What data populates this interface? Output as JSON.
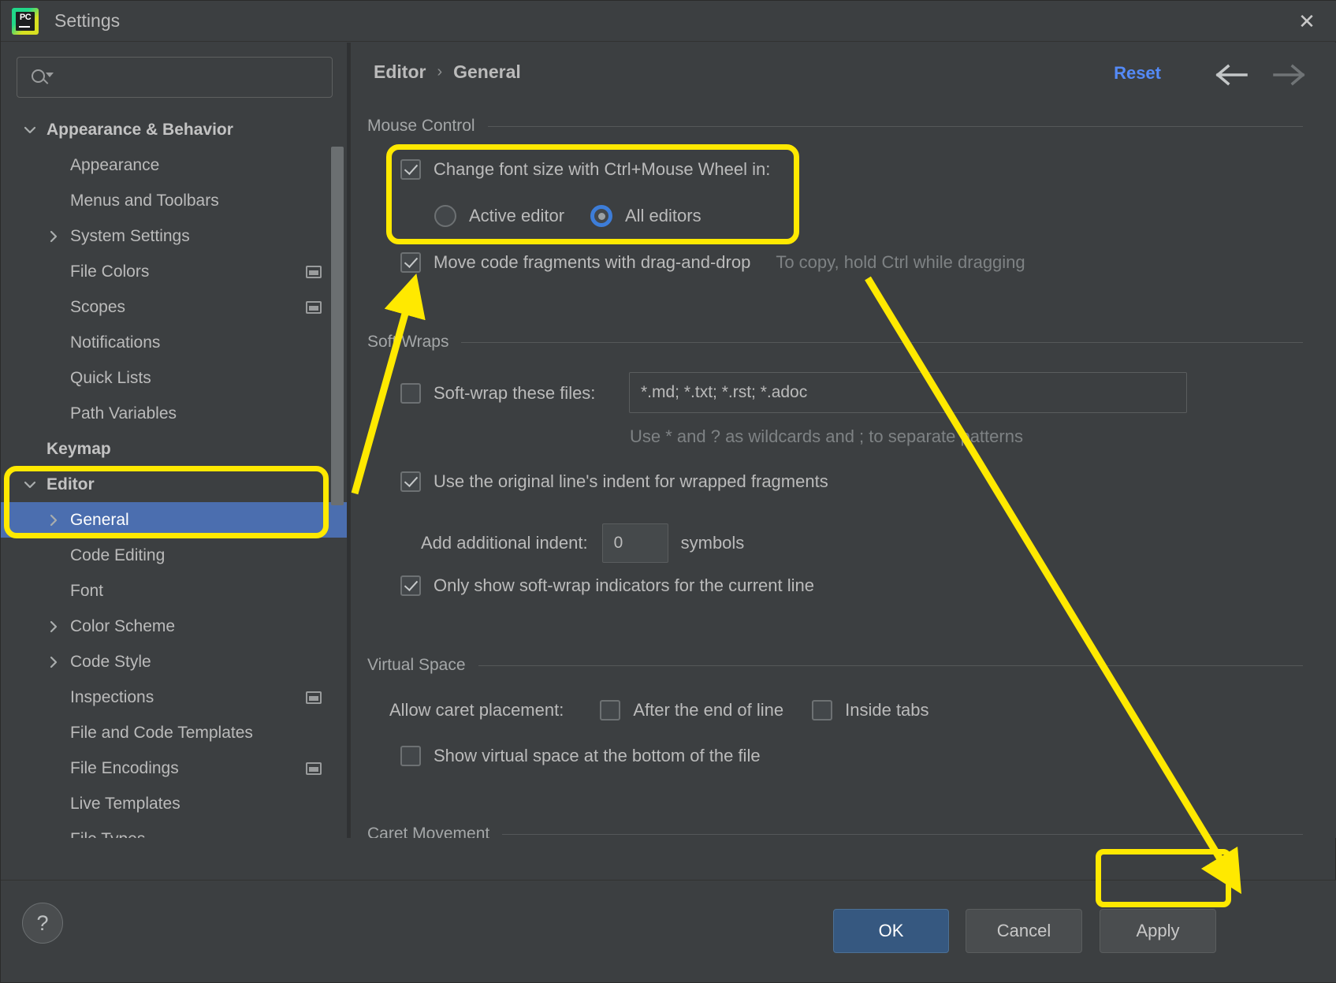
{
  "window": {
    "title": "Settings",
    "app_icon": "pycharm-logo-icon",
    "logo_text": "PC",
    "close_icon": "close-icon"
  },
  "search": {
    "value": "",
    "placeholder": "",
    "icon": "search-icon"
  },
  "sidebar": {
    "items": [
      {
        "label": "Appearance & Behavior",
        "level": 0,
        "twisty": "chevron-down-icon",
        "selected": false,
        "side_icon": false
      },
      {
        "label": "Appearance",
        "level": 1,
        "twisty": "",
        "selected": false,
        "side_icon": false
      },
      {
        "label": "Menus and Toolbars",
        "level": 1,
        "twisty": "",
        "selected": false,
        "side_icon": false
      },
      {
        "label": "System Settings",
        "level": 1,
        "twisty": "chevron-right-icon",
        "selected": false,
        "side_icon": false
      },
      {
        "label": "File Colors",
        "level": 1,
        "twisty": "",
        "selected": false,
        "side_icon": true
      },
      {
        "label": "Scopes",
        "level": 1,
        "twisty": "",
        "selected": false,
        "side_icon": true
      },
      {
        "label": "Notifications",
        "level": 1,
        "twisty": "",
        "selected": false,
        "side_icon": false
      },
      {
        "label": "Quick Lists",
        "level": 1,
        "twisty": "",
        "selected": false,
        "side_icon": false
      },
      {
        "label": "Path Variables",
        "level": 1,
        "twisty": "",
        "selected": false,
        "side_icon": false
      },
      {
        "label": "Keymap",
        "level": 0,
        "twisty": "",
        "selected": false,
        "side_icon": false
      },
      {
        "label": "Editor",
        "level": 0,
        "twisty": "chevron-down-icon",
        "selected": false,
        "side_icon": false
      },
      {
        "label": "General",
        "level": 1,
        "twisty": "chevron-right-icon",
        "selected": true,
        "side_icon": false
      },
      {
        "label": "Code Editing",
        "level": 1,
        "twisty": "",
        "selected": false,
        "side_icon": false
      },
      {
        "label": "Font",
        "level": 1,
        "twisty": "",
        "selected": false,
        "side_icon": false
      },
      {
        "label": "Color Scheme",
        "level": 1,
        "twisty": "chevron-right-icon",
        "selected": false,
        "side_icon": false
      },
      {
        "label": "Code Style",
        "level": 1,
        "twisty": "chevron-right-icon",
        "selected": false,
        "side_icon": false
      },
      {
        "label": "Inspections",
        "level": 1,
        "twisty": "",
        "selected": false,
        "side_icon": true
      },
      {
        "label": "File and Code Templates",
        "level": 1,
        "twisty": "",
        "selected": false,
        "side_icon": false
      },
      {
        "label": "File Encodings",
        "level": 1,
        "twisty": "",
        "selected": false,
        "side_icon": true
      },
      {
        "label": "Live Templates",
        "level": 1,
        "twisty": "",
        "selected": false,
        "side_icon": false
      },
      {
        "label": "File Types",
        "level": 1,
        "twisty": "",
        "selected": false,
        "side_icon": false
      }
    ]
  },
  "header": {
    "breadcrumb_parent": "Editor",
    "breadcrumb_sep": "›",
    "breadcrumb_current": "General",
    "reset_label": "Reset",
    "back_icon": "arrow-left-icon",
    "forward_icon": "arrow-right-icon"
  },
  "sections": {
    "mouse_control": {
      "title": "Mouse Control",
      "change_font_size": {
        "label": "Change font size with Ctrl+Mouse Wheel in:",
        "checked": true
      },
      "scope_options": [
        {
          "label": "Active editor",
          "selected": false
        },
        {
          "label": "All editors",
          "selected": true
        }
      ],
      "drag_drop": {
        "label": "Move code fragments with drag-and-drop",
        "checked": true
      },
      "drag_drop_hint": "To copy, hold Ctrl while dragging"
    },
    "soft_wraps": {
      "title": "Soft Wraps",
      "soft_wrap_files": {
        "label": "Soft-wrap these files:",
        "checked": false,
        "value": "*.md; *.txt; *.rst; *.adoc"
      },
      "wildcard_hint": "Use * and ? as wildcards and ; to separate patterns",
      "original_indent": {
        "label": "Use the original line's indent for wrapped fragments",
        "checked": true
      },
      "additional_indent": {
        "label": "Add additional indent:",
        "value": "0",
        "unit": "symbols"
      },
      "only_current_line": {
        "label": "Only show soft-wrap indicators for the current line",
        "checked": true
      }
    },
    "virtual_space": {
      "title": "Virtual Space",
      "caret_placement_label": "Allow caret placement:",
      "caret_options": [
        {
          "label": "After the end of line",
          "checked": false
        },
        {
          "label": "Inside tabs",
          "checked": false
        }
      ],
      "show_virtual_space": {
        "label": "Show virtual space at the bottom of the file",
        "checked": false
      }
    },
    "caret_movement": {
      "title": "Caret Movement"
    }
  },
  "footer": {
    "help_label": "?",
    "ok_label": "OK",
    "cancel_label": "Cancel",
    "apply_label": "Apply"
  },
  "annotations": {
    "color": "#ffe900",
    "boxes": [
      "mouse-control-option-highlight",
      "editor-general-sidebar-highlight",
      "apply-button-highlight"
    ],
    "arrows": [
      "arrow-to-sidebar-general",
      "arrow-to-apply-button"
    ]
  }
}
